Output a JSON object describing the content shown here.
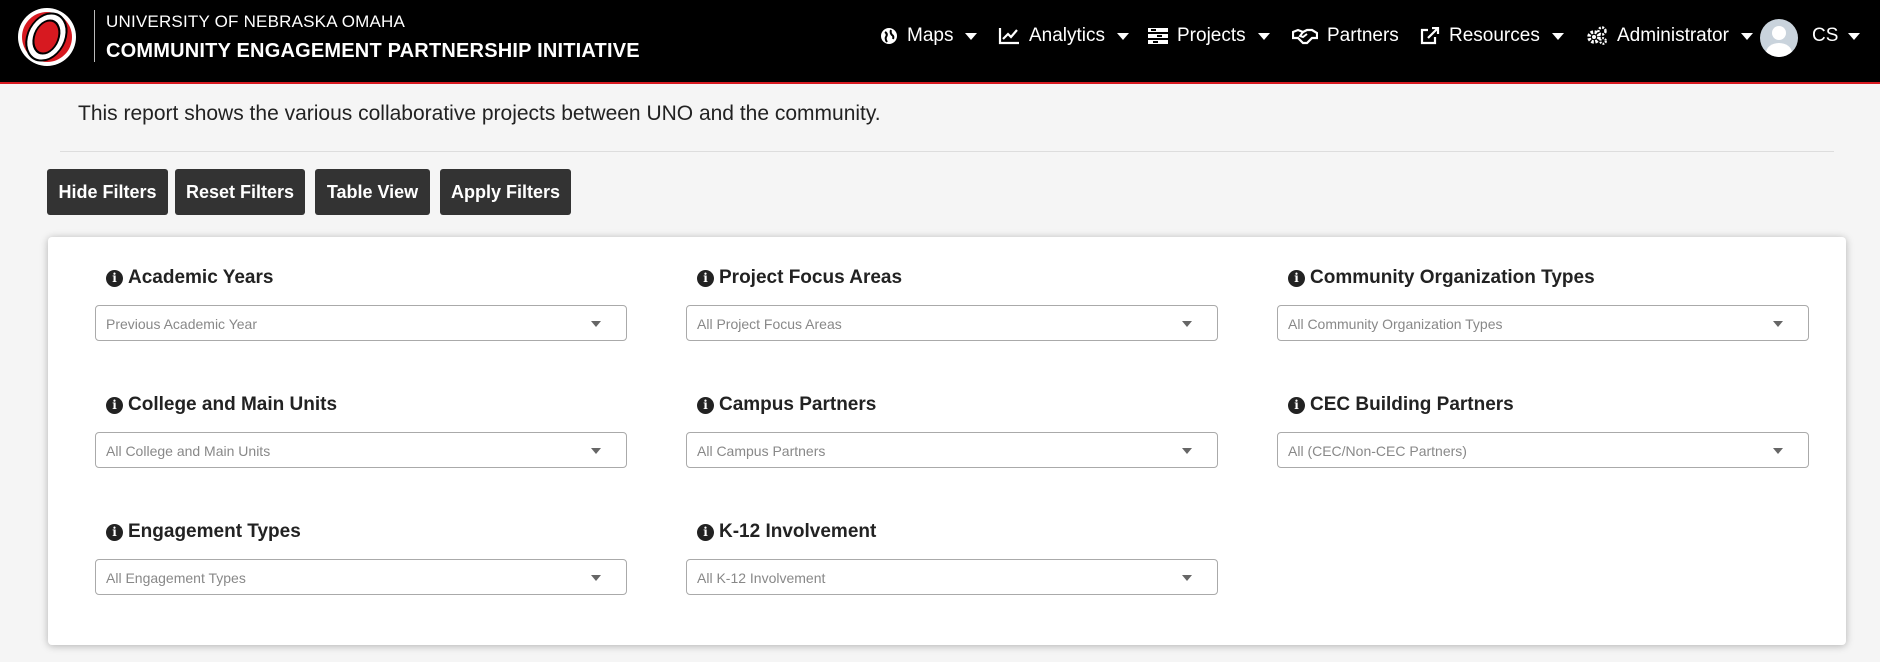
{
  "header": {
    "org_name": "UNIVERSITY OF NEBRASKA OMAHA",
    "app_title": "COMMUNITY ENGAGEMENT PARTNERSHIP INITIATIVE",
    "logo_icon": "uno-o-logo",
    "brand_color": "#d71920"
  },
  "nav": {
    "maps": "Maps",
    "analytics": "Analytics",
    "projects": "Projects",
    "partners": "Partners",
    "resources": "Resources",
    "administrator": "Administrator",
    "user_initials": "CS"
  },
  "intro_text": "This report shows the various collaborative projects between UNO and the community.",
  "buttons": {
    "hide_filters": "Hide Filters",
    "reset_filters": "Reset Filters",
    "table_view": "Table View",
    "apply_filters": "Apply Filters"
  },
  "filters": {
    "academic_years": {
      "label": "Academic Years",
      "value": "Previous Academic Year"
    },
    "project_focus_areas": {
      "label": "Project Focus Areas",
      "value": "All Project Focus Areas"
    },
    "community_org_types": {
      "label": "Community Organization Types",
      "value": "All Community Organization Types"
    },
    "college_units": {
      "label": "College and Main Units",
      "value": "All College and Main Units"
    },
    "campus_partners": {
      "label": "Campus Partners",
      "value": "All Campus Partners"
    },
    "cec_building_partners": {
      "label": "CEC Building Partners",
      "value": "All (CEC/Non-CEC Partners)"
    },
    "engagement_types": {
      "label": "Engagement Types",
      "value": "All Engagement Types"
    },
    "k12_involvement": {
      "label": "K-12 Involvement",
      "value": "All K-12 Involvement"
    }
  }
}
